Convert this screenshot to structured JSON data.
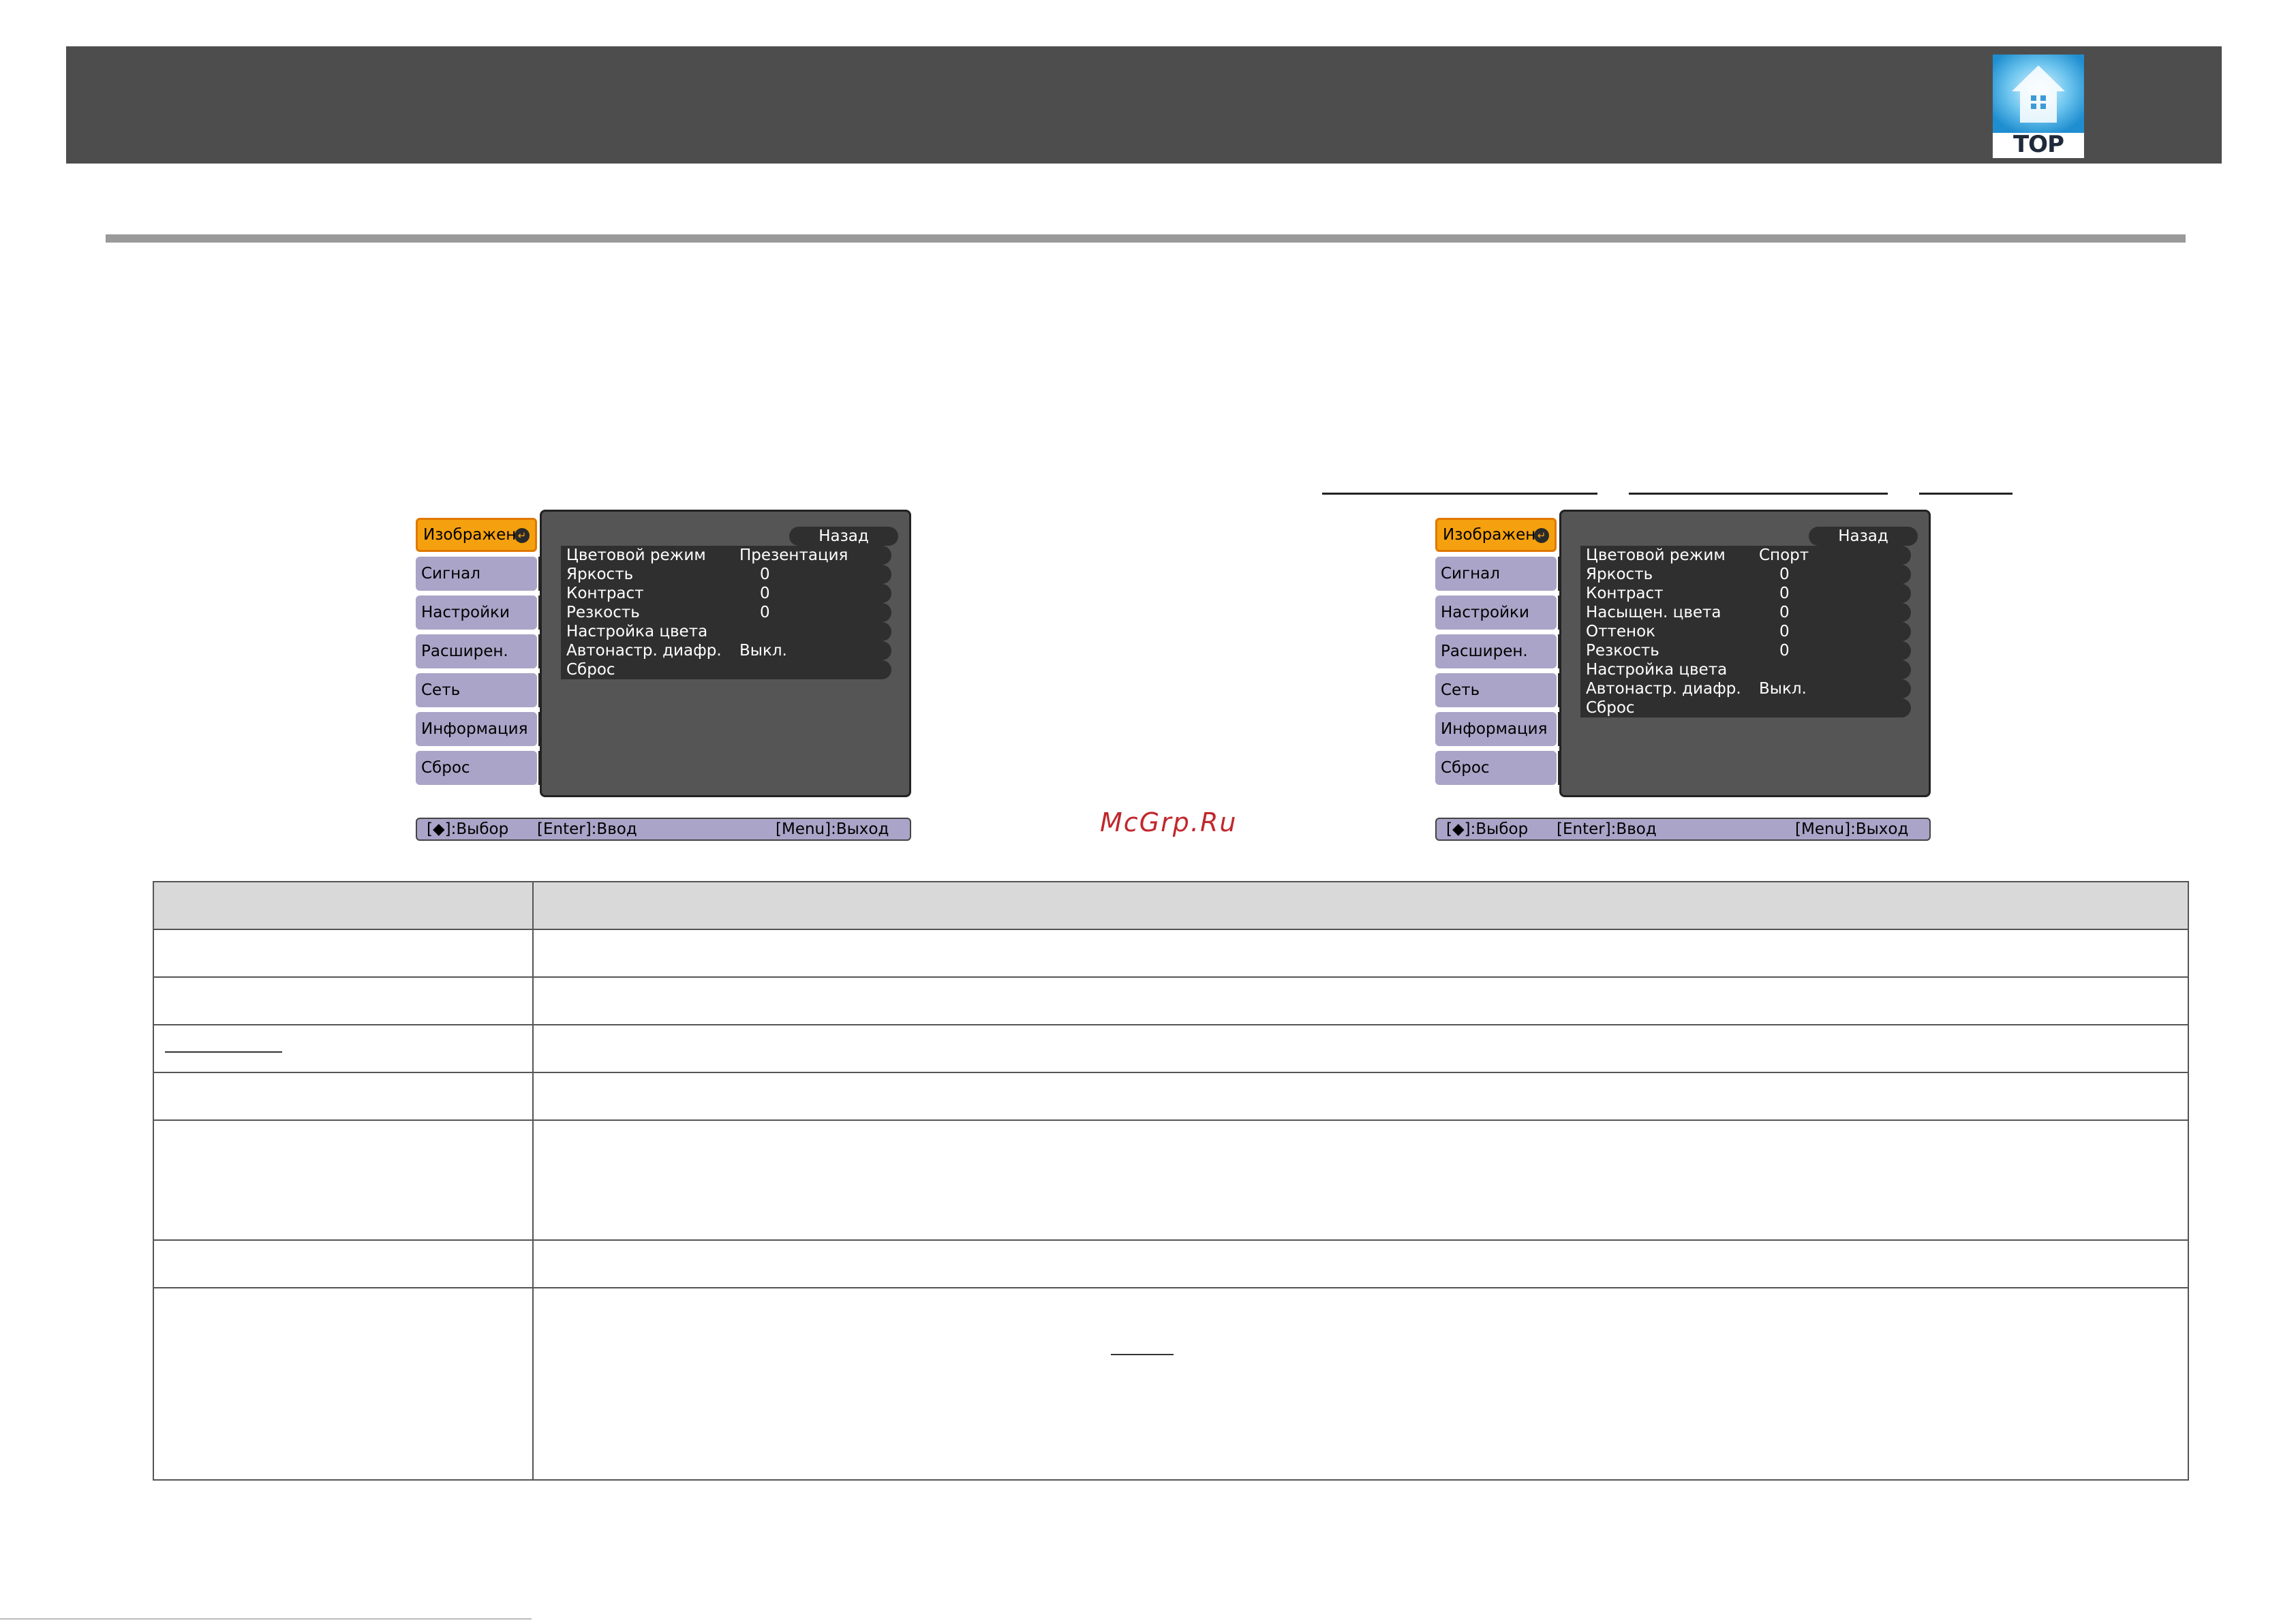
{
  "header": {
    "top_button_label": "TOP",
    "top_button_icon": "home-icon"
  },
  "watermark": "McGrp.Ru",
  "screens": [
    {
      "tabs": [
        {
          "label": "Изображен.",
          "active": true
        },
        {
          "label": "Сигнал",
          "active": false
        },
        {
          "label": "Настройки",
          "active": false
        },
        {
          "label": "Расширен.",
          "active": false
        },
        {
          "label": "Сеть",
          "active": false
        },
        {
          "label": "Информация",
          "active": false
        },
        {
          "label": "Сброс",
          "active": false
        }
      ],
      "back_label": "Назад",
      "rows": [
        {
          "label": "Цветовой режим",
          "value": "Презентация"
        },
        {
          "label": "Яркость",
          "value": "0"
        },
        {
          "label": "Контраст",
          "value": "0"
        },
        {
          "label": "Резкость",
          "value": "0"
        },
        {
          "label": "Настройка цвета",
          "value": ""
        },
        {
          "label": "Автонастр. диафр.",
          "value": "Выкл."
        },
        {
          "label": "Сброс",
          "value": ""
        }
      ],
      "status": {
        "select": "[◆]:Выбор",
        "enter": "[Enter]:Ввод",
        "exit": "[Menu]:Выход"
      }
    },
    {
      "tabs": [
        {
          "label": "Изображен.",
          "active": true
        },
        {
          "label": "Сигнал",
          "active": false
        },
        {
          "label": "Настройки",
          "active": false
        },
        {
          "label": "Расширен.",
          "active": false
        },
        {
          "label": "Сеть",
          "active": false
        },
        {
          "label": "Информация",
          "active": false
        },
        {
          "label": "Сброс",
          "active": false
        }
      ],
      "back_label": "Назад",
      "rows": [
        {
          "label": "Цветовой режим",
          "value": "Спорт"
        },
        {
          "label": "Яркость",
          "value": "0"
        },
        {
          "label": "Контраст",
          "value": "0"
        },
        {
          "label": "Насыщен. цвета",
          "value": "0"
        },
        {
          "label": "Оттенок",
          "value": "0"
        },
        {
          "label": "Резкость",
          "value": "0"
        },
        {
          "label": "Настройка цвета",
          "value": ""
        },
        {
          "label": "Автонастр. диафр.",
          "value": "Выкл."
        },
        {
          "label": "Сброс",
          "value": ""
        }
      ],
      "status": {
        "select": "[◆]:Выбор",
        "enter": "[Enter]:Ввод",
        "exit": "[Menu]:Выход"
      }
    }
  ],
  "colors": {
    "header_bg": "#4d4d4d",
    "active_tab": "#f5a10f",
    "tab": "#aaa4c8",
    "panel": "#555555",
    "table_header": "#d9d9d9",
    "watermark": "#c0282d"
  }
}
